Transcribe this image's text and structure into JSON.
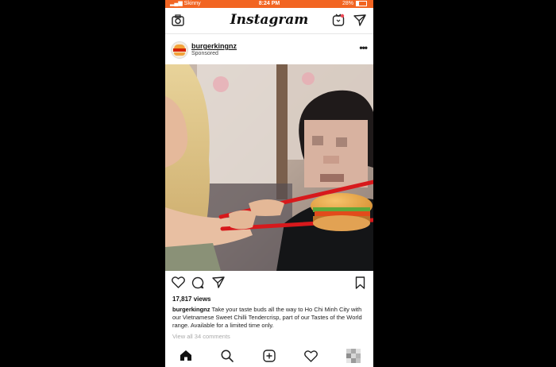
{
  "status_bar": {
    "carrier": "Skinny",
    "time": "8:24 PM",
    "battery": "28%",
    "battery_level": 0.28,
    "bar_color": "#f26522"
  },
  "top_bar": {
    "logo": "Instagram",
    "left_icon": "camera-icon",
    "right_icons": [
      "igtv-icon",
      "direct-send-icon"
    ]
  },
  "post": {
    "username": "burgerkingnz",
    "label": "Sponsored",
    "menu_glyph": "•••",
    "media_description_icons": [
      "burger",
      "red-chopsticks"
    ],
    "actions": [
      "heart-icon",
      "comment-icon",
      "share-icon",
      "bookmark-icon"
    ],
    "views": "17,817 views",
    "caption_user": "burgerkingnz",
    "caption_text": "Take your taste buds all the way to Ho Chi Minh City with our Vietnamese Sweet Chilli Tendercrisp, part of our Tastes of the World range. Available for a limited time only.",
    "comments_link": "View all 34 comments"
  },
  "bottom_nav": [
    "home-icon",
    "search-icon",
    "add-post-icon",
    "activity-icon",
    "profile-icon"
  ],
  "colors": {
    "accent": "#f26522",
    "chopsticks": "#d7191c",
    "text": "#111111"
  }
}
